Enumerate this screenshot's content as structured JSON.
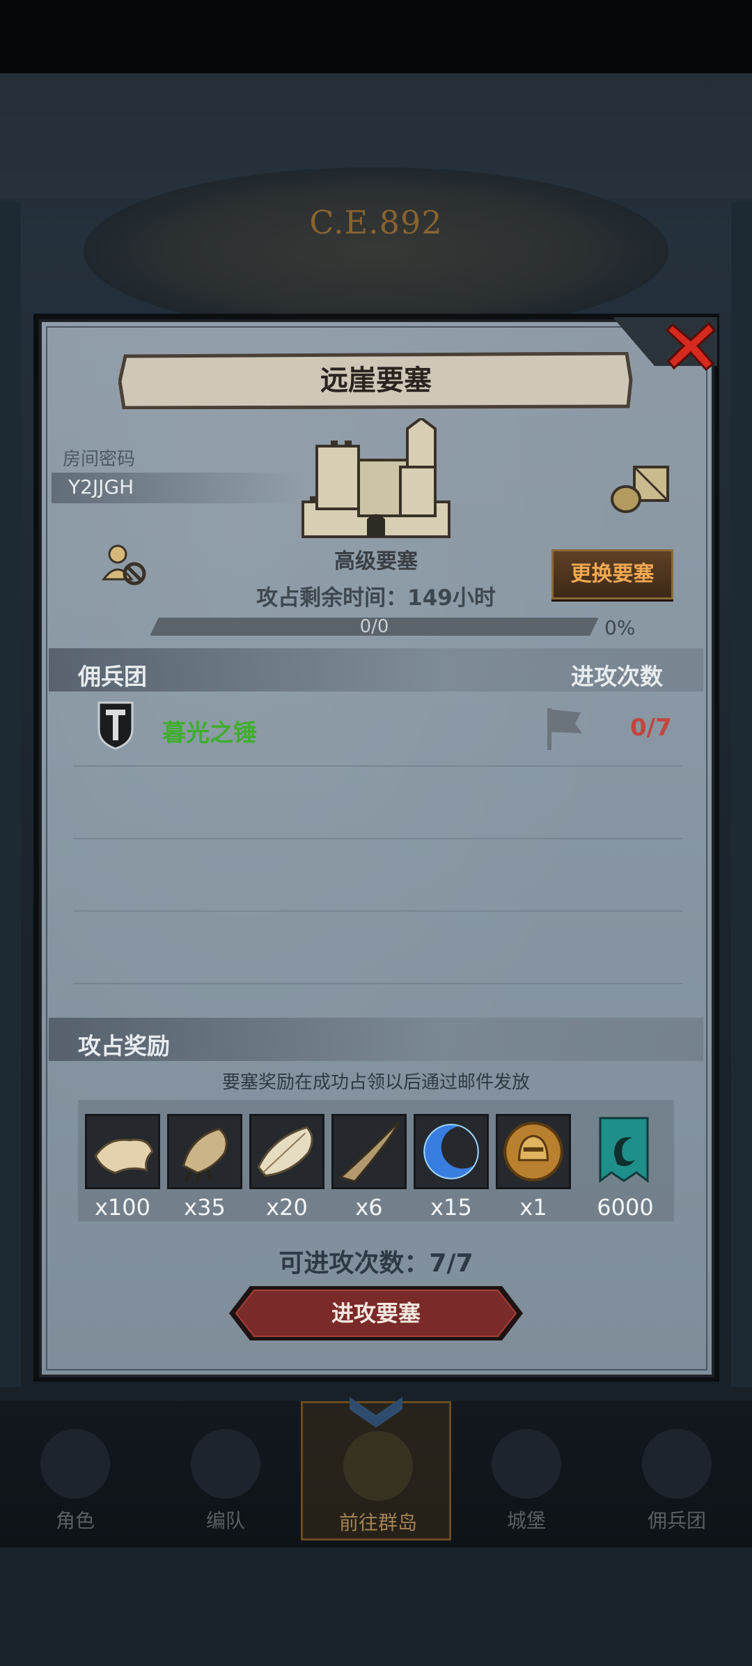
{
  "background": {
    "date_text": "C.E.892"
  },
  "panel": {
    "title": "远崖要塞",
    "room": {
      "label": "房间密码",
      "code": "Y2JJGH"
    },
    "fortress_level": "高级要塞",
    "change_fortress_label": "更换要塞",
    "time_remaining": "攻占剩余时间：149小时",
    "progress": {
      "text": "0/0",
      "percent_text": "0%",
      "fraction": 0
    }
  },
  "mercenaries": {
    "header_left": "佣兵团",
    "header_right": "进攻次数",
    "rows": [
      {
        "name": "暮光之锤",
        "attacks": "0/7",
        "name_color": "#3fae2e",
        "attacks_color": "#c2453e"
      }
    ]
  },
  "rewards": {
    "header": "攻占奖励",
    "note": "要塞奖励在成功占领以后通过邮件发放",
    "items": [
      {
        "icon": "fur-pelt-icon",
        "count": "x100"
      },
      {
        "icon": "claw-icon",
        "count": "x35"
      },
      {
        "icon": "feather-icon",
        "count": "x20"
      },
      {
        "icon": "horn-icon",
        "count": "x6"
      },
      {
        "icon": "blue-crescent-icon",
        "count": "x15"
      },
      {
        "icon": "helmet-medal-icon",
        "count": "x1"
      },
      {
        "icon": "guild-banner-icon",
        "count": "6000"
      }
    ]
  },
  "attack": {
    "remaining_text": "可进攻次数：7/7",
    "button_label": "进攻要塞"
  },
  "bottom_nav": [
    {
      "label": "角色",
      "icon": "knight-icon"
    },
    {
      "label": "编队",
      "icon": "formation-icon"
    },
    {
      "label": "前往群岛",
      "icon": "globe-icon",
      "selected": true
    },
    {
      "label": "城堡",
      "icon": "castle-icon"
    },
    {
      "label": "佣兵团",
      "icon": "mercenary-icon"
    }
  ],
  "colors": {
    "accent_orange": "#f1a851",
    "attack_red": "#7a2a28",
    "merc_green": "#3fae2e"
  }
}
